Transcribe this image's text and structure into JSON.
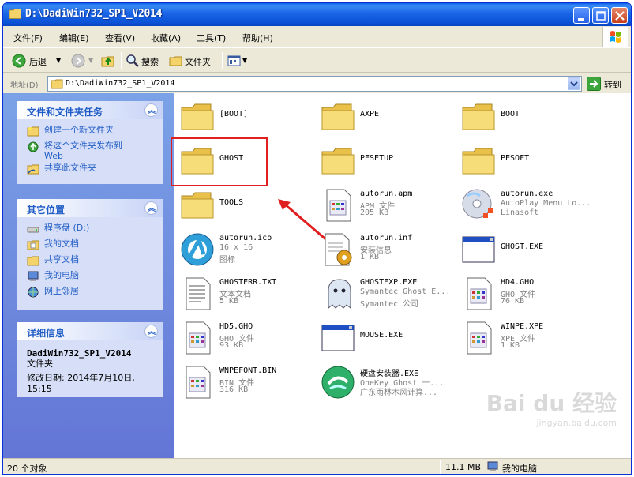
{
  "window": {
    "title": "D:\\DadiWin732_SP1_V2014"
  },
  "menu": [
    "文件(F)",
    "编辑(E)",
    "查看(V)",
    "收藏(A)",
    "工具(T)",
    "帮助(H)"
  ],
  "toolbar": {
    "back": "后退",
    "search": "搜索",
    "folders": "文件夹"
  },
  "address": {
    "label": "地址(D)",
    "path": "D:\\DadiWin732_SP1_V2014",
    "go": "转到"
  },
  "panels": {
    "tasks": {
      "title": "文件和文件夹任务",
      "items": [
        "创建一个新文件夹",
        "将这个文件夹发布到",
        "Web",
        "共享此文件夹"
      ]
    },
    "places": {
      "title": "其它位置",
      "items": [
        "程序盘 (D:)",
        "我的文档",
        "共享文档",
        "我的电脑",
        "网上邻居"
      ]
    },
    "details": {
      "title": "详细信息",
      "name": "DadiWin732_SP1_V2014",
      "type": "文件夹",
      "modified_label": "修改日期: 2014年7月10日,",
      "modified_time": "15:15"
    }
  },
  "files": [
    {
      "name": "[BOOT]",
      "kind": "folder"
    },
    {
      "name": "AXPE",
      "kind": "folder"
    },
    {
      "name": "BOOT",
      "kind": "folder"
    },
    {
      "name": "GHOST",
      "kind": "folder"
    },
    {
      "name": "PESETUP",
      "kind": "folder"
    },
    {
      "name": "PESOFT",
      "kind": "folder"
    },
    {
      "name": "TOOLS",
      "kind": "folder"
    },
    {
      "name": "autorun.apm",
      "sub1": "APM 文件",
      "sub2": "205 KB",
      "kind": "doc"
    },
    {
      "name": "autorun.exe",
      "sub1": "AutoPlay Menu Lo...",
      "sub2": "Linasoft",
      "kind": "cd"
    },
    {
      "name": "autorun.ico",
      "sub1": "16 x 16",
      "sub2": "图标",
      "kind": "ico"
    },
    {
      "name": "autorun.inf",
      "sub1": "安装信息",
      "sub2": "1 KB",
      "kind": "inf"
    },
    {
      "name": "GHOST.EXE",
      "kind": "exe"
    },
    {
      "name": "GHOSTERR.TXT",
      "sub1": "文本文档",
      "sub2": "5 KB",
      "kind": "txt"
    },
    {
      "name": "GHOSTEXP.EXE",
      "sub1": "Symantec Ghost E...",
      "sub2": "Symantec 公司",
      "kind": "ghost"
    },
    {
      "name": "HD4.GHO",
      "sub1": "GHO 文件",
      "sub2": "76 KB",
      "kind": "doc"
    },
    {
      "name": "HD5.GHO",
      "sub1": "GHO 文件",
      "sub2": "93 KB",
      "kind": "doc"
    },
    {
      "name": "MOUSE.EXE",
      "kind": "exe"
    },
    {
      "name": "WINPE.XPE",
      "sub1": "XPE 文件",
      "sub2": "1 KB",
      "kind": "doc"
    },
    {
      "name": "WNPEFONT.BIN",
      "sub1": "BIN 文件",
      "sub2": "316 KB",
      "kind": "doc"
    },
    {
      "name": "硬盘安装器.EXE",
      "sub1": "OneKey Ghost 一...",
      "sub2": "广东雨林木风计算...",
      "kind": "onekey"
    }
  ],
  "status": {
    "count": "20 个对象",
    "size": "11.1 MB",
    "location": "我的电脑"
  },
  "watermark": {
    "main": "Bai du 经验",
    "sub": "jingyan.baidu.com"
  }
}
